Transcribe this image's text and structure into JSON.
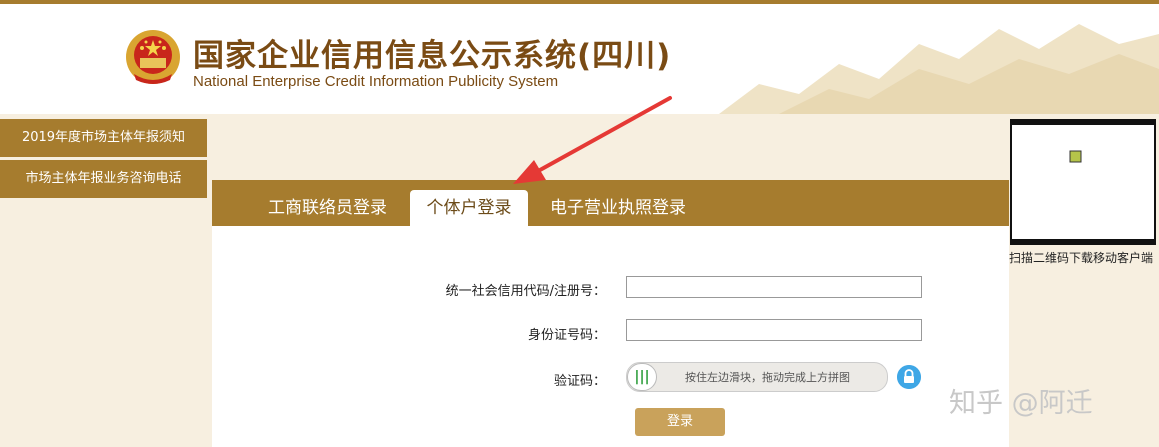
{
  "header": {
    "title_cn": "国家企业信用信息公示系统(四川)",
    "title_en": "National Enterprise Credit Information Publicity System"
  },
  "sidebar": {
    "items": [
      {
        "label": "2019年度市场主体年报须知"
      },
      {
        "label": "市场主体年报业务咨询电话"
      }
    ]
  },
  "tabs": [
    {
      "label": "工商联络员登录",
      "active": false
    },
    {
      "label": "个体户登录",
      "active": true
    },
    {
      "label": "电子营业执照登录",
      "active": false
    }
  ],
  "form": {
    "credit_code_label": "统一社会信用代码/注册号：",
    "credit_code_value": "",
    "id_label": "身份证号码：",
    "id_value": "",
    "captcha_label": "验证码：",
    "slider_text": "按住左边滑块，拖动完成上方拼图",
    "submit_label": "登录"
  },
  "qr": {
    "caption": "扫描二维码下载移动客户端"
  },
  "watermark": "知乎 @阿迁",
  "colors": {
    "brand": "#a67c2e",
    "title": "#7a4b14",
    "button": "#c9a25b",
    "arrow": "#e53935",
    "lock": "#3fa7e6"
  }
}
